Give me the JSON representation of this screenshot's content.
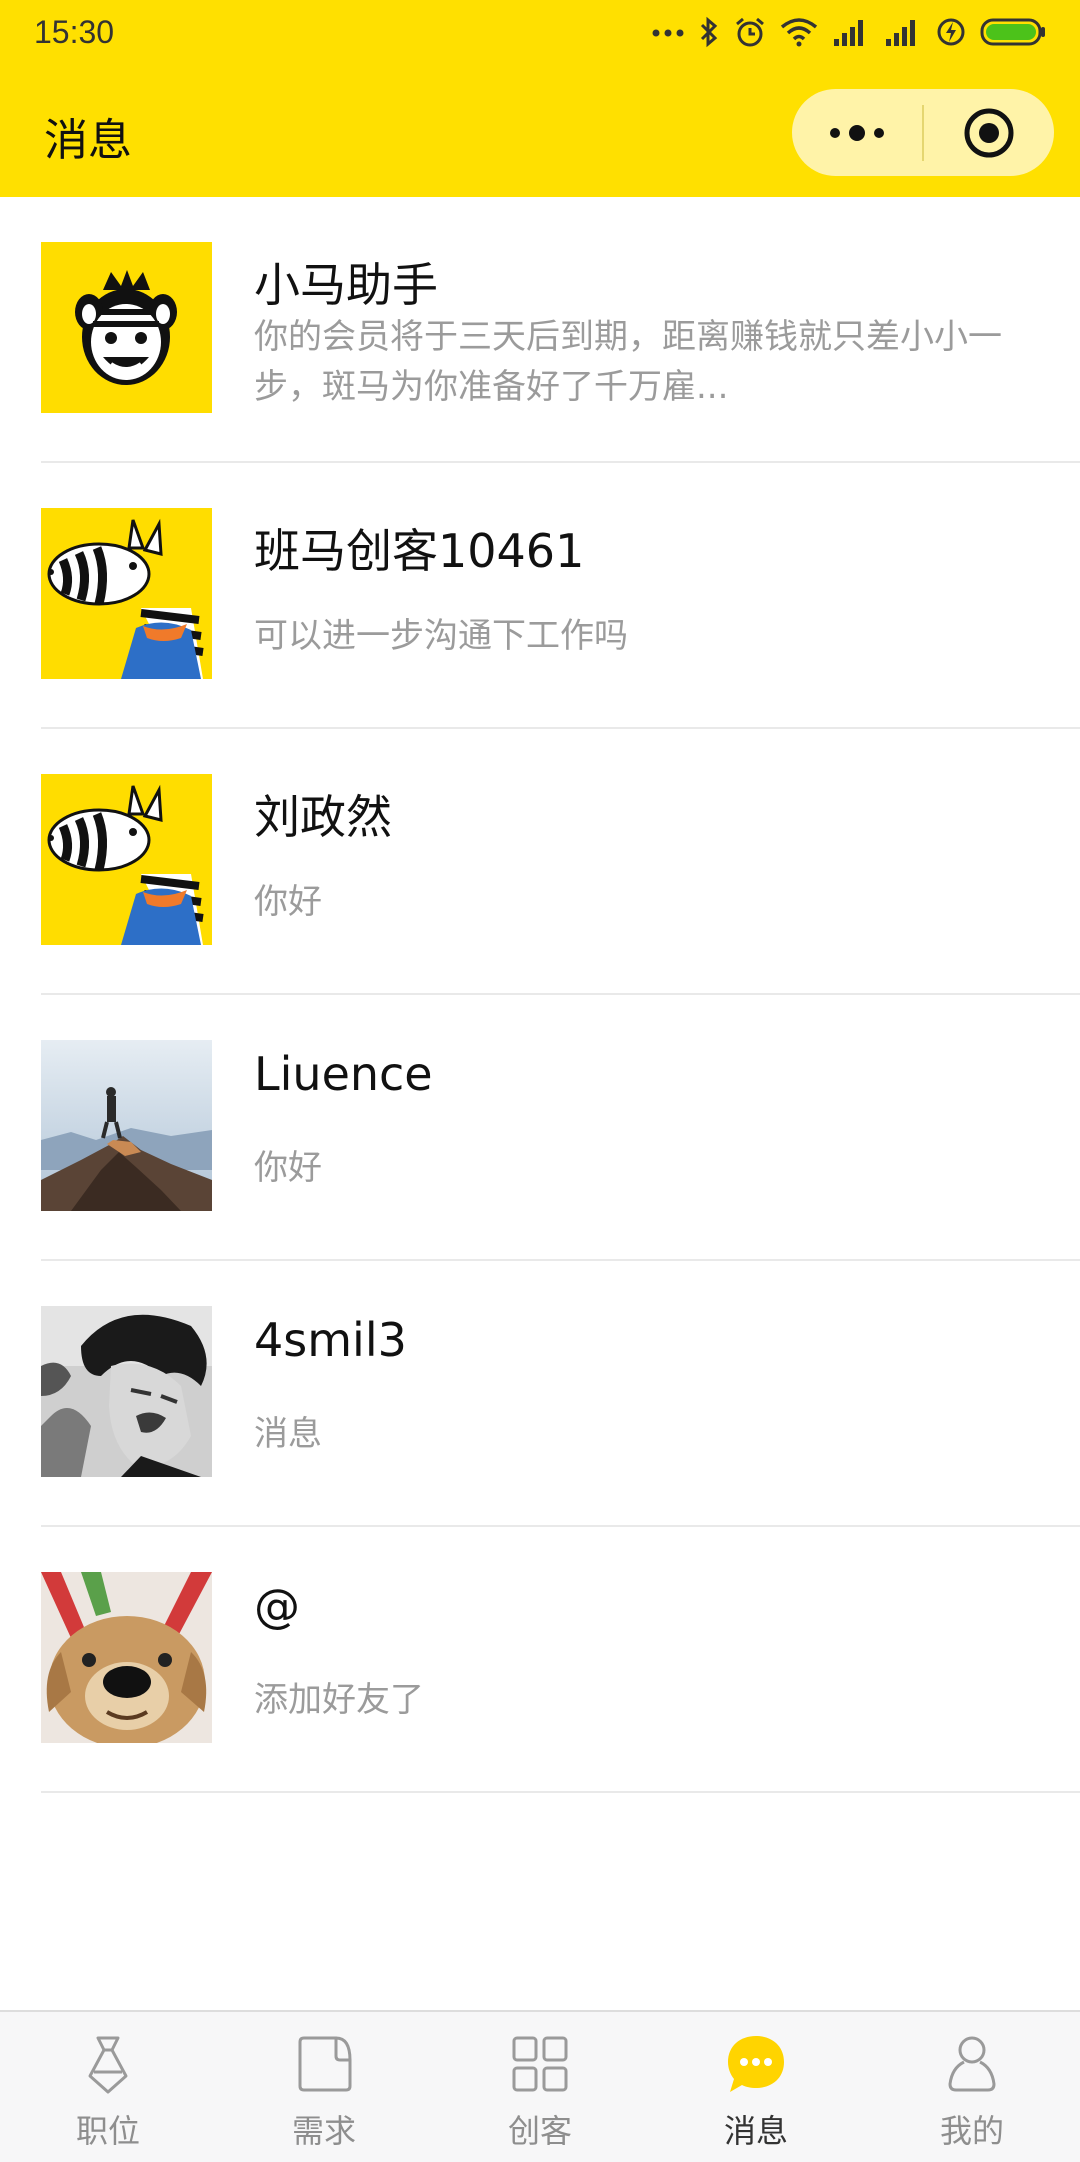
{
  "status_bar": {
    "time": "15:30"
  },
  "header": {
    "title": "消息"
  },
  "accent_color": "#FFE000",
  "messages": [
    {
      "name": "小马助手",
      "preview": "你的会员将于三天后到期，距离赚钱就只差小小一步，斑马为你准备好了千万雇...",
      "avatar": "zebra-face-avatar"
    },
    {
      "name": "班马创客10461",
      "preview": "可以进一步沟通下工作吗",
      "avatar": "zebra-cartoon-avatar"
    },
    {
      "name": "刘政然",
      "preview": "你好",
      "avatar": "zebra-cartoon-avatar"
    },
    {
      "name": "Liuence",
      "preview": "你好",
      "avatar": "mountain-photo-avatar"
    },
    {
      "name": "4smil3",
      "preview": "消息",
      "avatar": "bw-portrait-avatar"
    },
    {
      "name": "@",
      "preview": "添加好友了",
      "avatar": "dog-photo-avatar"
    }
  ],
  "tabs": [
    {
      "label": "职位",
      "icon": "tie-icon",
      "active": false
    },
    {
      "label": "需求",
      "icon": "document-icon",
      "active": false
    },
    {
      "label": "创客",
      "icon": "grid-icon",
      "active": false
    },
    {
      "label": "消息",
      "icon": "chat-bubble-icon",
      "active": true
    },
    {
      "label": "我的",
      "icon": "person-icon",
      "active": false
    }
  ]
}
